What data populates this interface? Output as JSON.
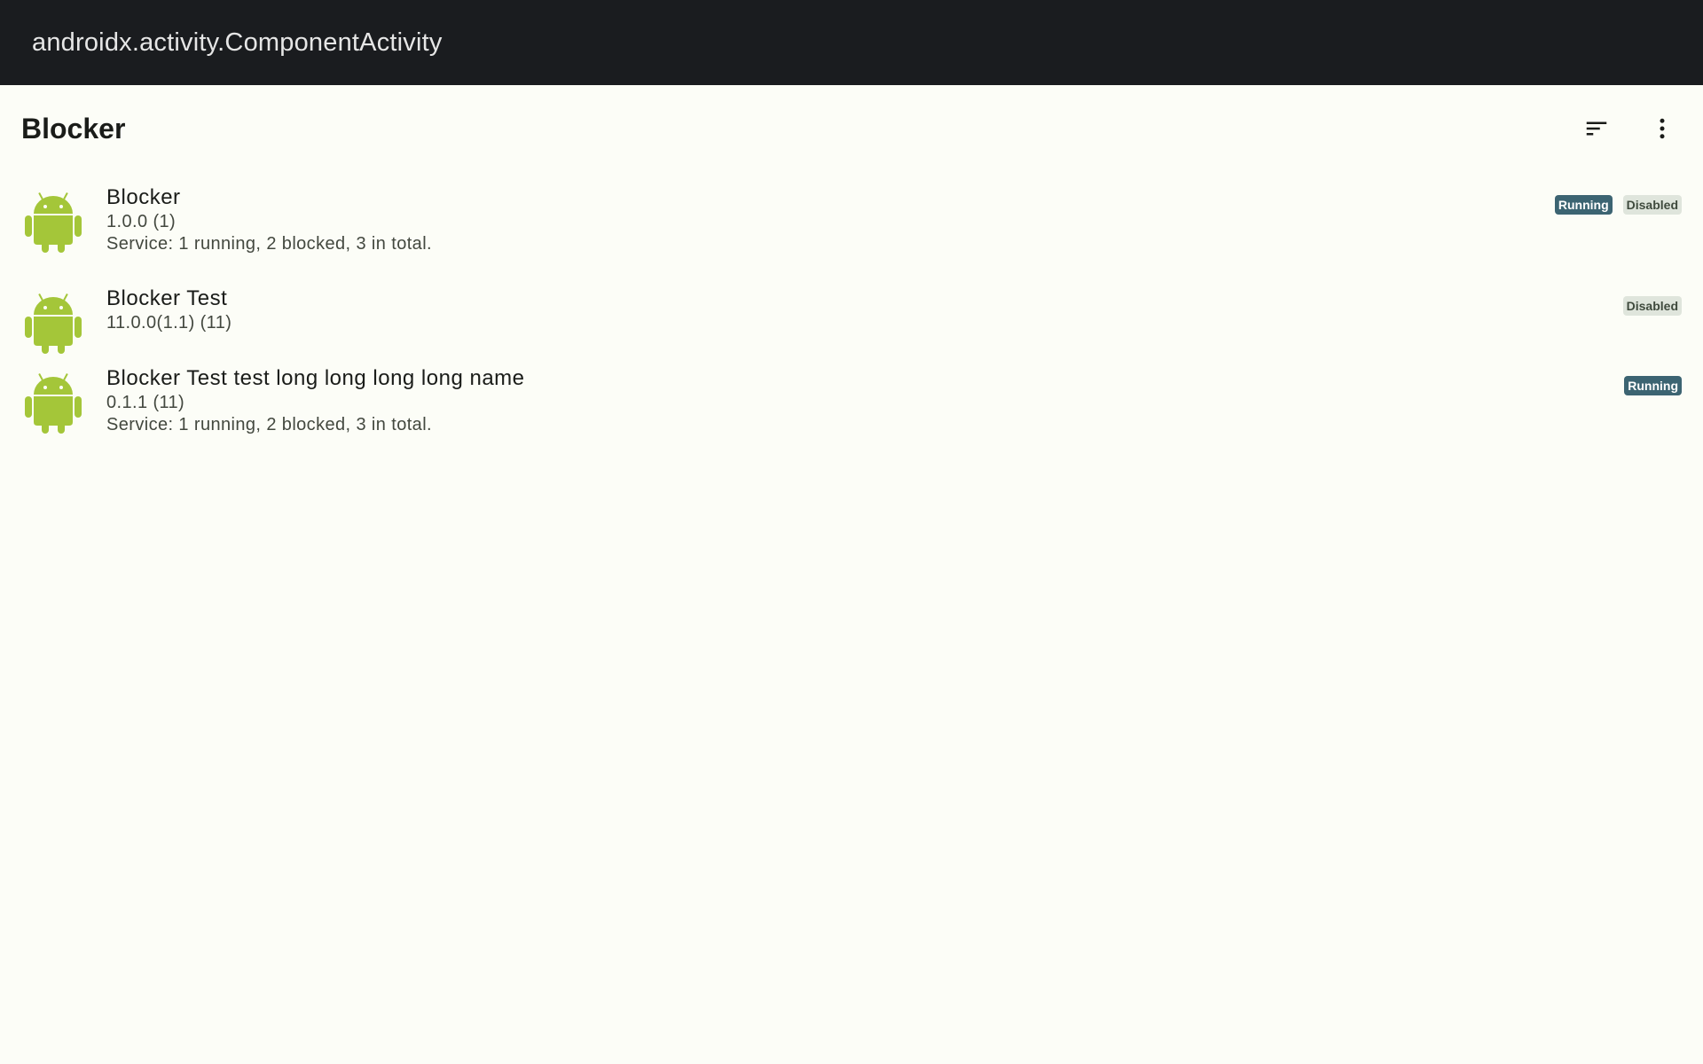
{
  "window": {
    "title": "androidx.activity.ComponentActivity"
  },
  "app_bar": {
    "title": "Blocker",
    "sort_icon": "sort-icon",
    "more_icon": "more-vert-icon"
  },
  "apps": [
    {
      "name": "Blocker",
      "version": "1.0.0 (1)",
      "service": "Service: 1 running, 2 blocked, 3 in total.",
      "icon": "android-icon",
      "tags": {
        "running": "Running",
        "disabled": "Disabled"
      }
    },
    {
      "name": "Blocker Test",
      "version": "11.0.0(1.1) (11)",
      "icon": "android-icon",
      "tags": {
        "disabled": "Disabled"
      }
    },
    {
      "name": "Blocker Test test long long long long name",
      "version": "0.1.1 (11)",
      "service": "Service: 1 running, 2 blocked, 3 in total.",
      "icon": "android-icon",
      "tags": {
        "running": "Running"
      }
    }
  ],
  "colors": {
    "window_bar": "#1a1c1f",
    "background": "#fcfdf7",
    "android_green": "#a4c639",
    "tag_running": "#3c6472",
    "tag_disabled": "#dfe5dc"
  }
}
